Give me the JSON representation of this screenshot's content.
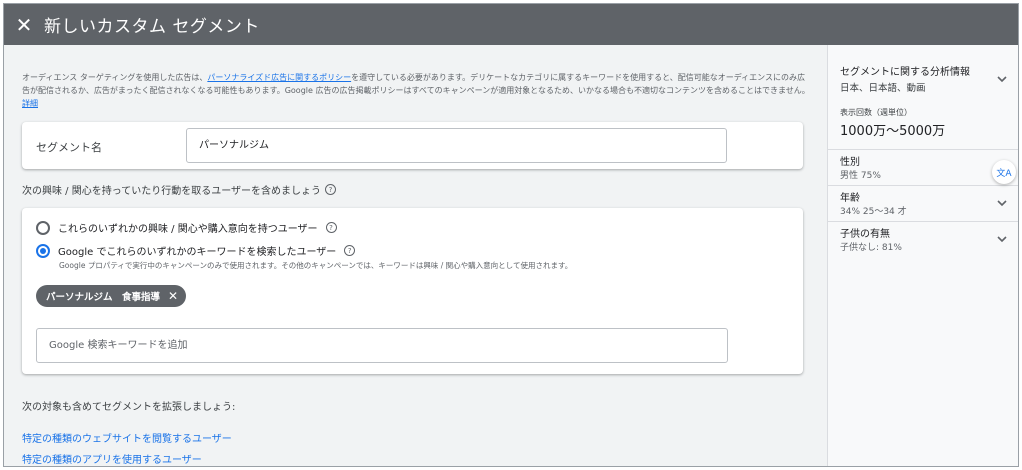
{
  "header": {
    "close_glyph": "✕",
    "title": "新しいカスタム セグメント"
  },
  "policy": {
    "text_before": "オーディエンス ターゲティングを使用した広告は、",
    "link_text": "パーソナライズド広告に関するポリシー",
    "text_after": "を遵守している必要があります。デリケートなカテゴリに属するキーワードを使用すると、配信可能なオーディエンスにのみ広告が配信されるか、広告がまったく配信されなくなる可能性もあります。Google 広告の広告掲載ポリシーはすべてのキャンペーンが適用対象となるため、いかなる場合も不適切なコンテンツを含めることはできません。",
    "details_link": "詳細"
  },
  "segment": {
    "label": "セグメント名",
    "value": "パーソナルジム"
  },
  "include": {
    "label": "次の興味 / 関心を持っていたり行動を取るユーザーを含めましょう",
    "options": [
      {
        "label": "これらのいずれかの興味 / 関心や購入意向を持つユーザー",
        "checked": false
      },
      {
        "label": "Google でこれらのいずれかのキーワードを検索したユーザー",
        "checked": true
      }
    ],
    "option_note": "Google プロパティで実行中のキャンペーンのみで使用されます。その他のキャンペーンでは、キーワードは興味 / 関心や購入意向として使用されます。",
    "chip": "パーソナルジム　食事指導",
    "keyword_placeholder": "Google 検索キーワードを追加"
  },
  "expand": {
    "label": "次の対象も含めてセグメントを拡張しましょう:",
    "links": [
      "特定の種類のウェブサイトを閲覧するユーザー",
      "特定の種類のアプリを使用するユーザー"
    ]
  },
  "insights": {
    "title": "セグメントに関する分析情報",
    "subtitle": "日本、日本語、動画",
    "impressions_label": "表示回数（週単位）",
    "impressions_value": "1000万〜5000万",
    "gender_title": "性別",
    "gender_value": "男性 75%",
    "age_title": "年齢",
    "age_value": "34% 25〜34 才",
    "parent_title": "子供の有無",
    "parent_value": "子供なし: 81%"
  },
  "icons": {
    "help": "?",
    "chevron": "chevron-down-icon",
    "translate": "translate-icon"
  },
  "colors": {
    "header_bg": "#5f6368",
    "accent": "#1a73e8"
  }
}
